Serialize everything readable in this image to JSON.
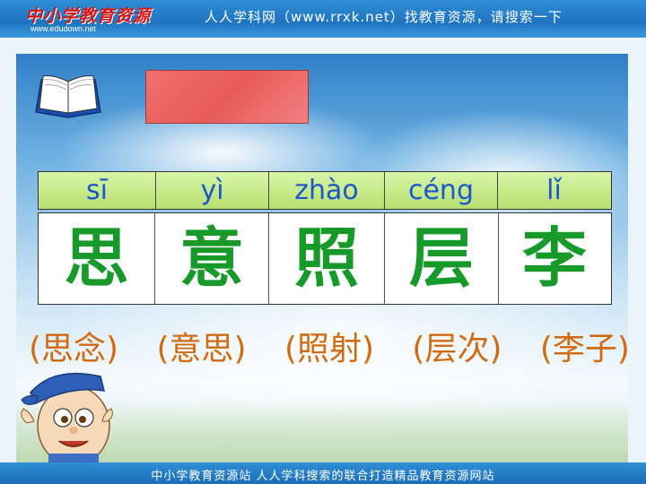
{
  "header": {
    "logo_text": "中小学教育资源",
    "logo_url_text": "www.edudown.net",
    "slogan": "人人学科网（www.rrxk.net）找教育资源，请搜索一下"
  },
  "pinyin": [
    "sī",
    "yì",
    "zhào",
    "céng",
    "lǐ"
  ],
  "characters": [
    "思",
    "意",
    "照",
    "层",
    "李"
  ],
  "words": [
    "(思念)",
    "(意思)",
    "(照射)",
    "(层次)",
    "(李子)"
  ],
  "footer": {
    "text": "中小学教育资源站 人人学科搜索的联合打造精品教育资源网站"
  },
  "colors": {
    "header_bg": "#1f73bf",
    "pinyin_text": "#1d57c9",
    "character_text": "#179a2a",
    "word_text": "#d26a12",
    "title_box": "#e85a5a"
  },
  "icons": [
    "open-book-icon",
    "cartoon-boy-icon"
  ]
}
